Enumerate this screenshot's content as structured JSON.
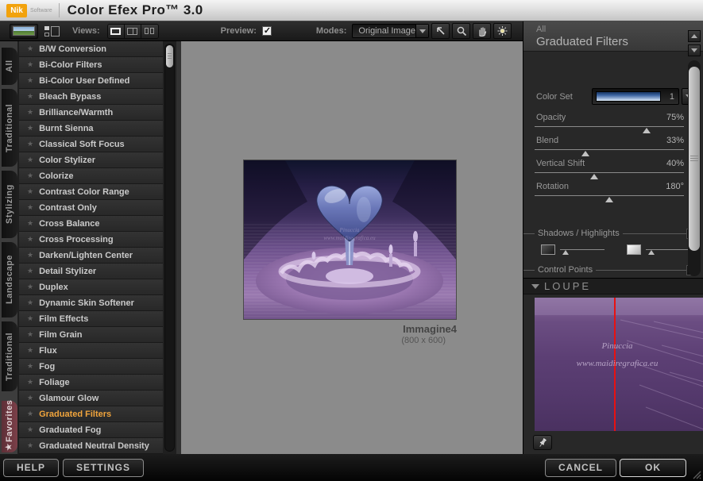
{
  "app": {
    "brand": "Nik",
    "brand_sub": "Software",
    "title": "Color Efex Pro™ 3.0"
  },
  "toolbar": {
    "views_label": "Views:",
    "preview_label": "Preview:",
    "preview_checked": true,
    "modes_label": "Modes:",
    "modes_value": "Original Image"
  },
  "categories": [
    {
      "label": "All"
    },
    {
      "label": "Traditional"
    },
    {
      "label": "Stylizing"
    },
    {
      "label": "Landscape"
    },
    {
      "label": "Traditional"
    },
    {
      "label": "Favorites"
    }
  ],
  "filters": {
    "items": [
      {
        "label": "B/W Conversion"
      },
      {
        "label": "Bi-Color Filters"
      },
      {
        "label": "Bi-Color User Defined"
      },
      {
        "label": "Bleach Bypass"
      },
      {
        "label": "Brilliance/Warmth"
      },
      {
        "label": "Burnt Sienna"
      },
      {
        "label": "Classical Soft Focus"
      },
      {
        "label": "Color Stylizer"
      },
      {
        "label": "Colorize"
      },
      {
        "label": "Contrast Color Range"
      },
      {
        "label": "Contrast Only"
      },
      {
        "label": "Cross Balance"
      },
      {
        "label": "Cross Processing"
      },
      {
        "label": "Darken/Lighten Center"
      },
      {
        "label": "Detail Stylizer"
      },
      {
        "label": "Duplex"
      },
      {
        "label": "Dynamic Skin Softener"
      },
      {
        "label": "Film Effects"
      },
      {
        "label": "Film Grain"
      },
      {
        "label": "Flux"
      },
      {
        "label": "Fog"
      },
      {
        "label": "Foliage"
      },
      {
        "label": "Glamour Glow"
      },
      {
        "label": "Graduated Filters",
        "selected": true
      },
      {
        "label": "Graduated Fog"
      },
      {
        "label": "Graduated Neutral Density"
      }
    ]
  },
  "preview": {
    "image_name": "Immagine4",
    "image_size": "(800 x 600)",
    "watermark_line1": "Pinuccia",
    "watermark_line2": "www.maidiregrafica.eu"
  },
  "panel": {
    "category": "All",
    "title": "Graduated Filters",
    "color_set_label": "Color Set",
    "color_set_value": "1",
    "sliders": [
      {
        "label": "Opacity",
        "value": "75%",
        "percent": 75
      },
      {
        "label": "Blend",
        "value": "33%",
        "percent": 34
      },
      {
        "label": "Vertical Shift",
        "value": "40%",
        "percent": 40
      },
      {
        "label": "Rotation",
        "value": "180°",
        "percent": 50
      }
    ],
    "shadows_highlights_label": "Shadows / Highlights",
    "control_points_label": "Control Points",
    "loupe_label": "LOUPE"
  },
  "footer": {
    "help": "HELP",
    "settings": "SETTINGS",
    "cancel": "CANCEL",
    "ok": "OK"
  },
  "colors": {
    "brand_orange": "#f2a20c",
    "selected_filter": "#f0a43c",
    "favorites_tab": "#73383f",
    "loupe_line": "#e81111",
    "color_set_swatch_top": "#16335f",
    "color_set_swatch_bottom": "#dce9f6"
  },
  "icons": [
    "photo-thumbnail-icon",
    "layout-grid-icon",
    "view-single-icon",
    "view-split-icon",
    "view-dual-icon",
    "checkbox-check-icon",
    "dropdown-arrow-icon",
    "select-arrow-icon",
    "magnifier-icon",
    "pan-hand-icon",
    "lightbulb-icon",
    "expander-arrow-icon",
    "collapse-triangle-icon",
    "scroll-up-icon",
    "scroll-down-icon",
    "pushpin-icon",
    "favorites-star-icon",
    "filter-star-icon",
    "resize-grip-icon"
  ]
}
